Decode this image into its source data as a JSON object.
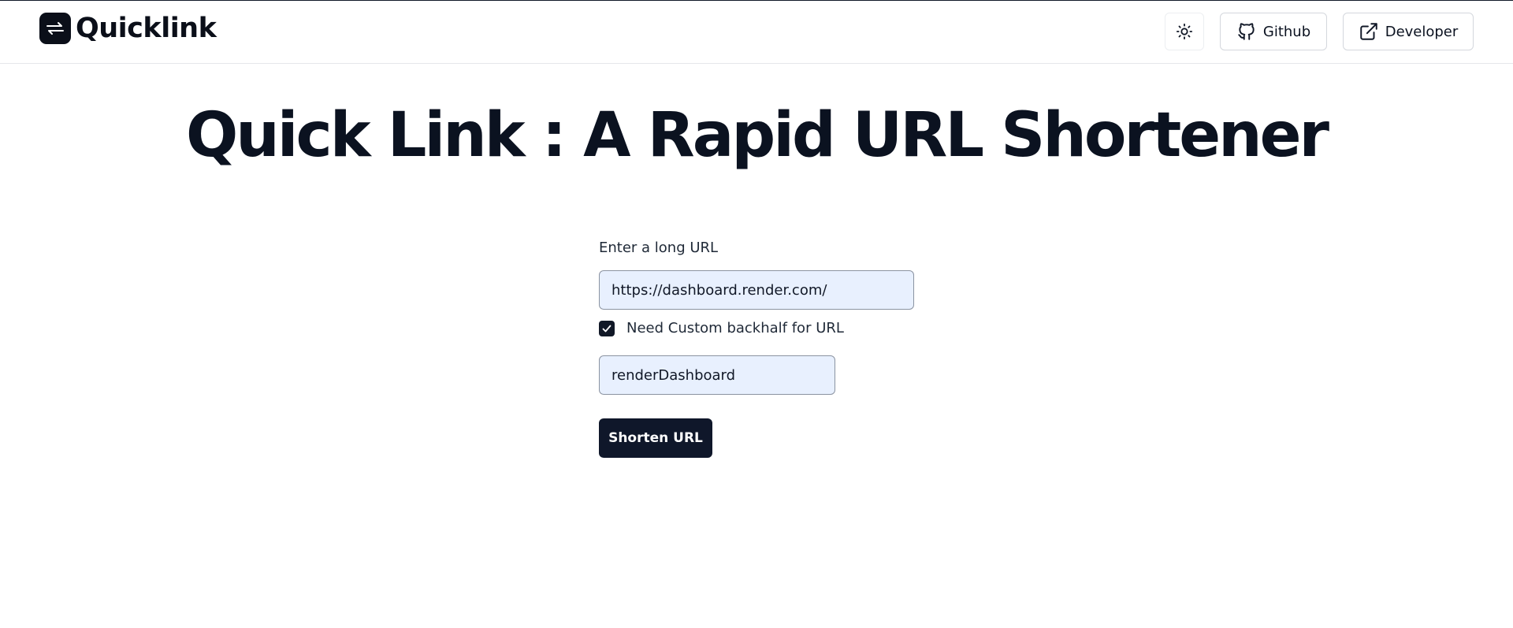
{
  "brand": {
    "name": "Quicklink"
  },
  "header": {
    "theme_toggle_icon": "sun-icon",
    "github_label": "Github",
    "developer_label": "Developer"
  },
  "main": {
    "title": "Quick Link : A Rapid URL Shortener",
    "url_label": "Enter a long URL",
    "url_value": "https://dashboard.render.com/",
    "custom_checkbox_label": "Need Custom backhalf for URL",
    "custom_checked": true,
    "backhalf_value": "renderDashboard",
    "submit_label": "Shorten URL"
  },
  "colors": {
    "primary": "#0f172a",
    "input_bg": "#e8f0fe",
    "border": "#d4d7dd"
  }
}
